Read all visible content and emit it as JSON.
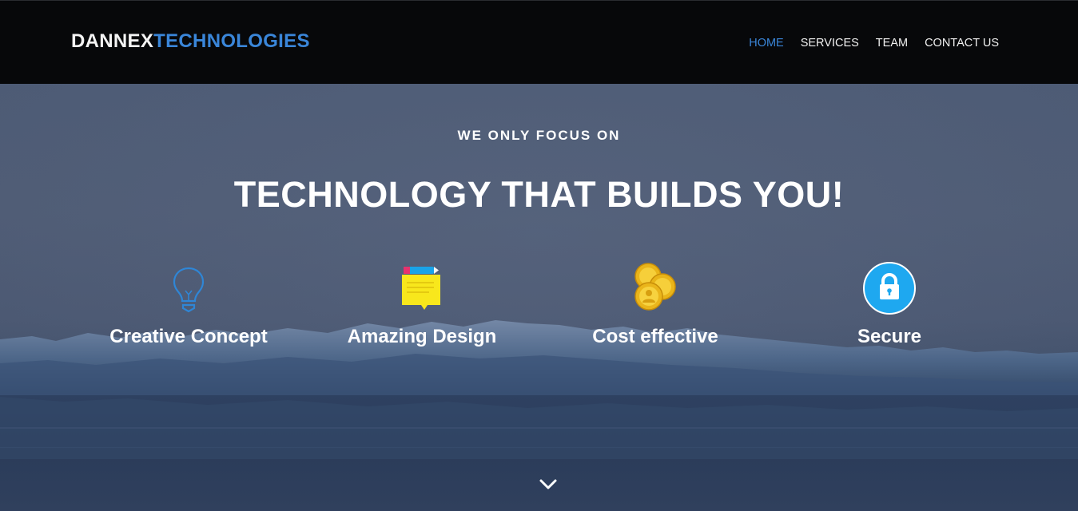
{
  "brand": {
    "part1": "DANNEX",
    "part2": "TECHNOLOGIES"
  },
  "nav": {
    "items": [
      {
        "label": "HOME",
        "active": true
      },
      {
        "label": "SERVICES",
        "active": false
      },
      {
        "label": "TEAM",
        "active": false
      },
      {
        "label": "CONTACT US",
        "active": false
      }
    ]
  },
  "hero": {
    "eyebrow": "WE ONLY FOCUS ON",
    "headline": "TECHNOLOGY THAT BUILDS YOU!",
    "features": [
      {
        "label": "Creative Concept",
        "icon": "lightbulb-icon"
      },
      {
        "label": "Amazing Design",
        "icon": "sticky-note-icon"
      },
      {
        "label": "Cost effective",
        "icon": "coins-icon"
      },
      {
        "label": "Secure",
        "icon": "lock-icon"
      }
    ],
    "scroll_icon": "chevron-down-icon"
  },
  "colors": {
    "header_bg": "#07080a",
    "accent": "#3a86d9",
    "hero_bg": "#4c5a74",
    "text": "#ffffff"
  }
}
